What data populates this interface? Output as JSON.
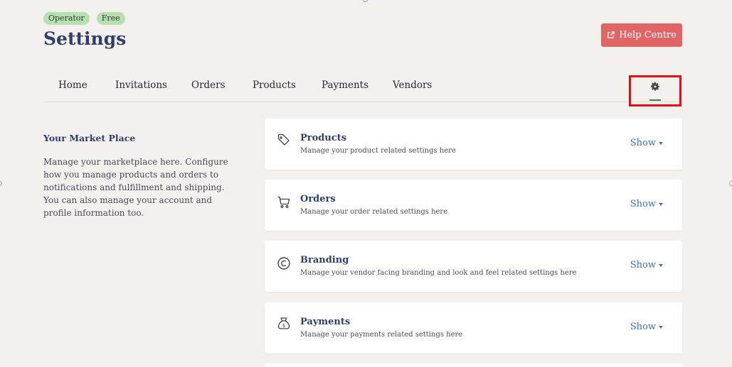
{
  "header": {
    "badges": [
      "Operator",
      "Free"
    ],
    "title": "Settings",
    "help_label": "Help Centre"
  },
  "nav": {
    "items": [
      "Home",
      "Invitations",
      "Orders",
      "Products",
      "Payments",
      "Vendors"
    ],
    "settings_icon": "gear-icon",
    "active": "settings"
  },
  "left": {
    "title": "Your Market Place",
    "description": "Manage your marketplace here. Configure how you manage products and orders to notifications and fulfillment and shipping. You can also manage your account and profile information too."
  },
  "cards": [
    {
      "icon": "tag-icon",
      "title": "Products",
      "subtitle": "Manage your product related settings here",
      "action": "Show"
    },
    {
      "icon": "cart-icon",
      "title": "Orders",
      "subtitle": "Manage your order related settings here",
      "action": "Show"
    },
    {
      "icon": "copyright-icon",
      "title": "Branding",
      "subtitle": "Manage your vendor facing branding and look and feel related settings here",
      "action": "Show"
    },
    {
      "icon": "money-bag-icon",
      "title": "Payments",
      "subtitle": "Manage your payments related settings here",
      "action": "Show"
    }
  ],
  "colors": {
    "background": "#f4f0ee",
    "title": "#2f3f6b",
    "help_button": "#e06666",
    "badge": "#b7e0b0",
    "link": "#3b6fc0",
    "highlight": "#e01010",
    "active_underline": "#2f8a4a"
  }
}
